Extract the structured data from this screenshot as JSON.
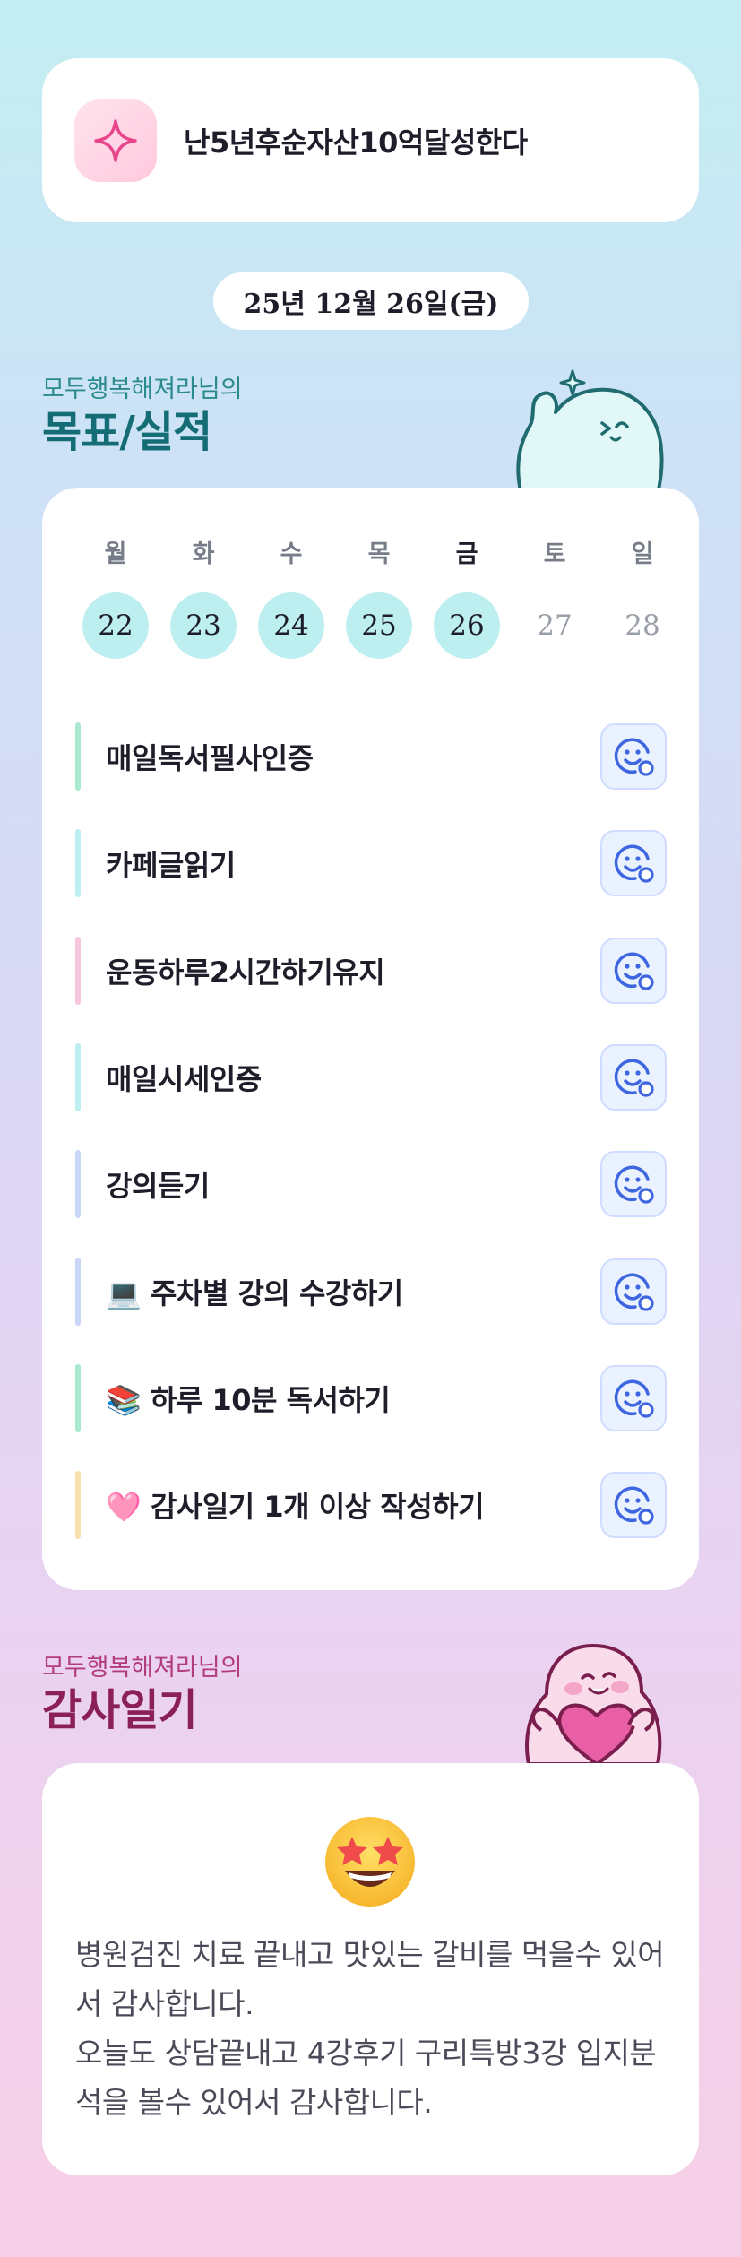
{
  "goal": {
    "text": "난5년후순자산10억달성한다",
    "icon": "sparkle-icon"
  },
  "date_label": "25년 12월 26일(금)",
  "goals_section": {
    "subtitle": "모두행복해져라님의",
    "title": "목표/실적"
  },
  "week": {
    "days": [
      {
        "day": "월",
        "date": "22",
        "state": "done"
      },
      {
        "day": "화",
        "date": "23",
        "state": "done"
      },
      {
        "day": "수",
        "date": "24",
        "state": "done"
      },
      {
        "day": "목",
        "date": "25",
        "state": "done"
      },
      {
        "day": "금",
        "date": "26",
        "state": "today"
      },
      {
        "day": "토",
        "date": "27",
        "state": "future"
      },
      {
        "day": "일",
        "date": "28",
        "state": "future"
      }
    ]
  },
  "tasks": [
    {
      "label": "매일독서필사인증",
      "bar_color": "#a8e9cf",
      "action_icon": "smiley-clock-icon"
    },
    {
      "label": "카페글읽기",
      "bar_color": "#bdeef0",
      "action_icon": "smiley-clock-icon"
    },
    {
      "label": "운동하루2시간하기유지",
      "bar_color": "#f6c6dc",
      "action_icon": "smiley-clock-icon"
    },
    {
      "label": "매일시세인증",
      "bar_color": "#bdeef0",
      "action_icon": "smiley-clock-icon"
    },
    {
      "label": "강의듣기",
      "bar_color": "#c9d6f6",
      "action_icon": "smiley-clock-icon"
    },
    {
      "label": "💻 주차별 강의 수강하기",
      "bar_color": "#c9d6f6",
      "action_icon": "smiley-clock-icon"
    },
    {
      "label": "📚 하루 10분 독서하기",
      "bar_color": "#a8e9cf",
      "action_icon": "smiley-clock-icon"
    },
    {
      "label": "🩷 감사일기 1개 이상 작성하기",
      "bar_color": "#f7dfae",
      "action_icon": "smiley-clock-icon"
    }
  ],
  "gratitude_section": {
    "subtitle": "모두행복해져라님의",
    "title": "감사일기"
  },
  "gratitude": {
    "emoji": "star-struck-emoji",
    "lines": [
      "병원검진 치료 끝내고 맛있는 갈비를 먹을수 있어서 감사합니다.",
      "오늘도 상담끝내고 4강후기 구리특방3강 입지분석을 볼수 있어서 감사합니다."
    ]
  }
}
